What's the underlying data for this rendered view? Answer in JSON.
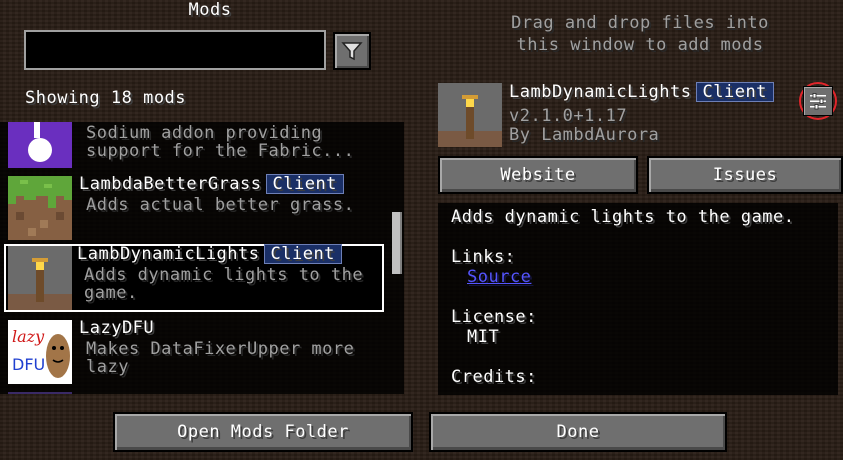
{
  "screen": {
    "title": "Mods",
    "drop_hint_line1": "Drag and drop files into",
    "drop_hint_line2": "this window to add mods"
  },
  "search": {
    "value": "",
    "placeholder": ""
  },
  "showing": "Showing 18 mods",
  "mods": [
    {
      "name": "",
      "badge": "",
      "desc1": "Sodium addon providing",
      "desc2": "support for the Fabric..."
    },
    {
      "name": "LambdaBetterGrass",
      "badge": "Client",
      "desc1": "Adds actual better grass.",
      "desc2": ""
    },
    {
      "name": "LambDynamicLights",
      "badge": "Client",
      "desc1": "Adds dynamic lights to the",
      "desc2": "game."
    },
    {
      "name": "LazyDFU",
      "badge": "",
      "desc1": "Makes DataFixerUpper more",
      "desc2": "lazy"
    }
  ],
  "lazydfu_logo": {
    "top": "lazy",
    "bottom": "DFU"
  },
  "selected": {
    "name": "LambDynamicLights",
    "badge": "Client",
    "version": "v2.1.0+1.17",
    "author": "By LambdAurora",
    "website_label": "Website",
    "issues_label": "Issues",
    "description": "Adds dynamic lights to the game.",
    "links_label": "Links:",
    "source_label": "Source",
    "license_label": "License:",
    "license_value": "MIT",
    "credits_label": "Credits:"
  },
  "buttons": {
    "open_folder": "Open Mods Folder",
    "done": "Done"
  },
  "colors": {
    "badge_bg": "#1a2f66",
    "link": "#5555ff",
    "config_highlight": "#e0252b"
  }
}
